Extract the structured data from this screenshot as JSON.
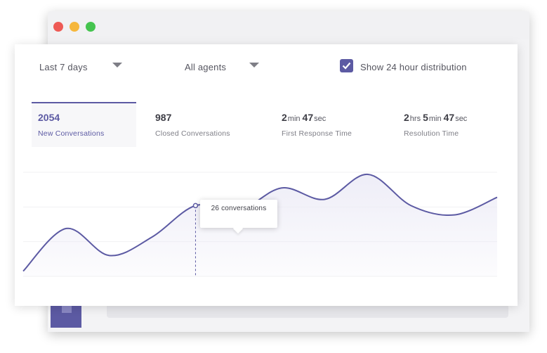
{
  "window": {
    "controls": [
      "close",
      "minimize",
      "maximize"
    ],
    "colors": {
      "close": "#ee5a55",
      "minimize": "#f6b73c",
      "maximize": "#45c44f"
    }
  },
  "filters": {
    "period": "Last 7 days",
    "agents": "All agents",
    "distribution_label": "Show 24 hour distribution",
    "distribution_checked": true
  },
  "metrics": [
    {
      "value": "2054",
      "label": "New Conversations",
      "active": true
    },
    {
      "value": "987",
      "label": "Closed Conversations",
      "active": false
    },
    {
      "value_parts": [
        {
          "n": "2",
          "u": "min"
        },
        {
          "n": "47",
          "u": "sec"
        }
      ],
      "label": "First Response Time",
      "active": false
    },
    {
      "value_parts": [
        {
          "n": "2",
          "u": "hrs"
        },
        {
          "n": "5",
          "u": "min"
        },
        {
          "n": "47",
          "u": "sec"
        }
      ],
      "label": "Resolution Time",
      "active": false
    }
  ],
  "tooltip": {
    "text": "26 conversations"
  },
  "colors": {
    "accent": "#5c5aa3",
    "fill": "#ecebf6"
  },
  "chart_data": {
    "type": "area",
    "series": [
      {
        "values": [
          0.05,
          0.46,
          0.2,
          0.38,
          0.68,
          0.63,
          0.85,
          0.74,
          0.98,
          0.68,
          0.59,
          0.76
        ]
      }
    ],
    "highlight_index": 4,
    "grid": true
  }
}
